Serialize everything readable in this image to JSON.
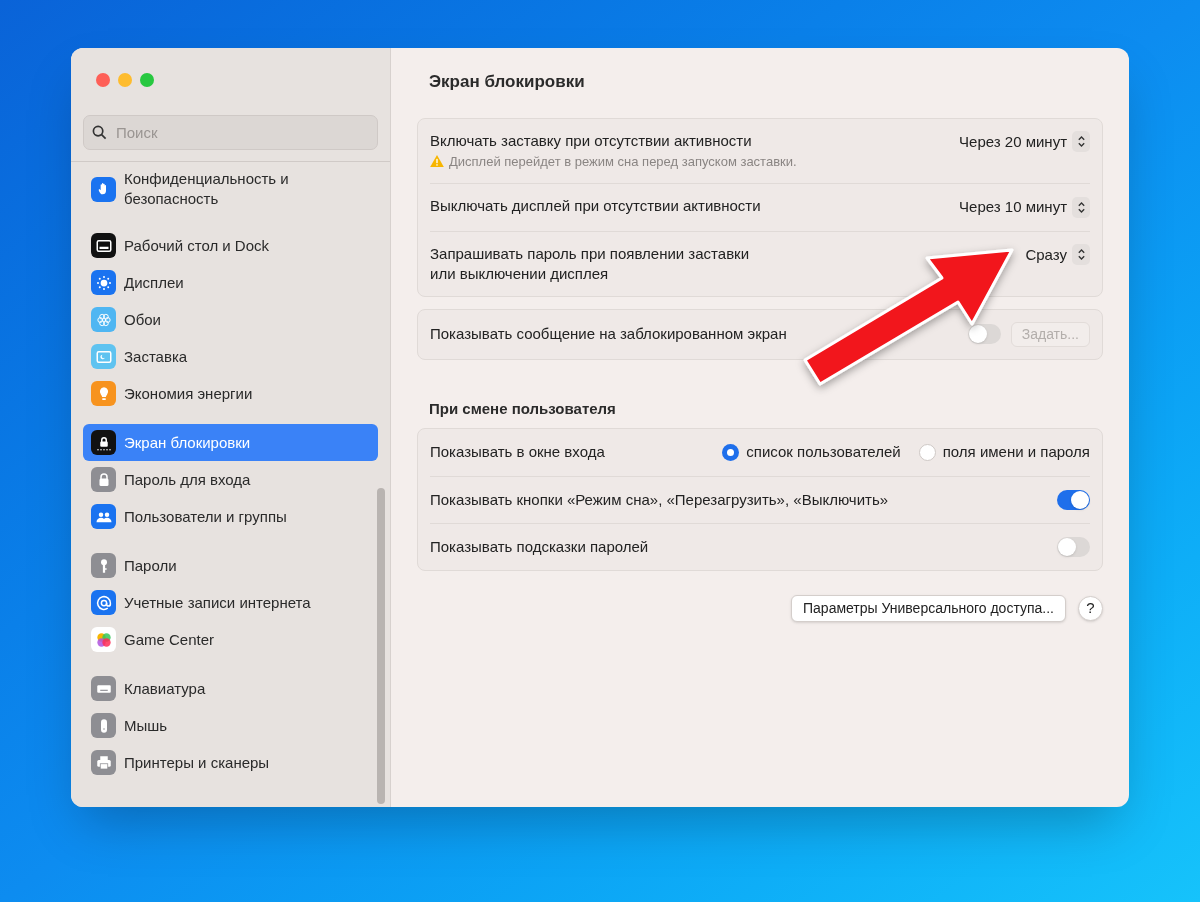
{
  "sidebar": {
    "search": {
      "placeholder": "Поиск"
    },
    "groups": [
      [
        {
          "label": "Конфиденциальность и безопасность",
          "kind": "hand",
          "selected": false
        }
      ],
      [
        {
          "label": "Рабочий стол и Dock",
          "kind": "dock",
          "selected": false
        },
        {
          "label": "Дисплеи",
          "kind": "sun",
          "selected": false
        },
        {
          "label": "Обои",
          "kind": "flower",
          "selected": false
        },
        {
          "label": "Заставка",
          "kind": "screensaver",
          "selected": false
        },
        {
          "label": "Экономия энергии",
          "kind": "bulb",
          "selected": false
        }
      ],
      [
        {
          "label": "Экран блокировки",
          "kind": "lock_screen",
          "selected": true
        },
        {
          "label": "Пароль для входа",
          "kind": "lock",
          "selected": false
        },
        {
          "label": "Пользователи и группы",
          "kind": "users",
          "selected": false
        }
      ],
      [
        {
          "label": "Пароли",
          "kind": "key",
          "selected": false
        },
        {
          "label": "Учетные записи интернета",
          "kind": "at",
          "selected": false
        },
        {
          "label": "Game Center",
          "kind": "bubbles",
          "selected": false
        }
      ],
      [
        {
          "label": "Клавиатура",
          "kind": "keyboard",
          "selected": false
        },
        {
          "label": "Мышь",
          "kind": "mouse",
          "selected": false
        },
        {
          "label": "Принтеры и сканеры",
          "kind": "printer",
          "selected": false
        }
      ]
    ]
  },
  "title": "Экран блокировки",
  "card_1": [
    {
      "kind": "popup",
      "label": "Включать заставку при отсутствии активности",
      "note": "Дисплей перейдет в режим сна перед запуском заставки.",
      "value": "Через 20 минут"
    },
    {
      "kind": "popup",
      "label": "Выключать дисплей при отсутствии активности",
      "value": "Через 10 минут"
    },
    {
      "kind": "popup",
      "label": "Запрашивать пароль при появлении заставки\nили выключении дисплея",
      "value": "Сразу"
    }
  ],
  "card_2": {
    "label": "Показывать сообщение на заблокированном экран",
    "on": false,
    "button": {
      "label": "Задать...",
      "disabled": true
    }
  },
  "section_2": {
    "title": "При смене пользователя",
    "rows": [
      {
        "kind": "radio",
        "label": "Показывать в окне входа",
        "options": [
          {
            "label": "список пользователей",
            "selected": true
          },
          {
            "label": "поля имени и пароля",
            "selected": false
          }
        ]
      },
      {
        "kind": "toggle",
        "label": "Показывать кнопки «Режим сна», «Перезагрузить», «Выключить»",
        "on": true
      },
      {
        "kind": "toggle",
        "label": "Показывать подсказки паролей",
        "on": false
      }
    ]
  },
  "footer": {
    "button": "Параметры Универсального доступа...",
    "help": "?"
  }
}
